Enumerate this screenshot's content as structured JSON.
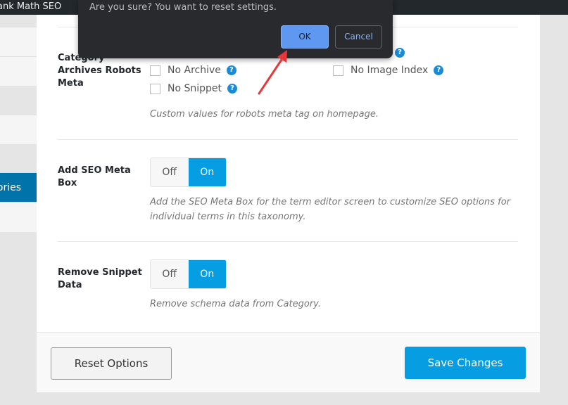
{
  "topbar": {
    "title": "ank Math SEO"
  },
  "sidebar": {
    "active_label": "ories",
    "accent": "#0073aa"
  },
  "robots": {
    "label": "Category Archives Robots Meta",
    "options": [
      {
        "label": "No Archive",
        "checked": false
      },
      {
        "label": "No Snippet",
        "checked": false
      },
      {
        "label": "No Image Index",
        "checked": false
      }
    ],
    "description": "Custom values for robots meta tag on homepage."
  },
  "meta_box": {
    "label": "Add SEO Meta Box",
    "off": "Off",
    "on": "On",
    "value": "On",
    "description": "Add the SEO Meta Box for the term editor screen to customize SEO options for individual terms in this taxonomy."
  },
  "snippet": {
    "label": "Remove Snippet Data",
    "off": "Off",
    "on": "On",
    "value": "On",
    "description": "Remove schema data from Category."
  },
  "footer": {
    "reset": "Reset Options",
    "save": "Save Changes"
  },
  "dialog": {
    "message": "Are you sure? You want to reset settings.",
    "ok": "OK",
    "cancel": "Cancel"
  },
  "help_glyph": "?"
}
